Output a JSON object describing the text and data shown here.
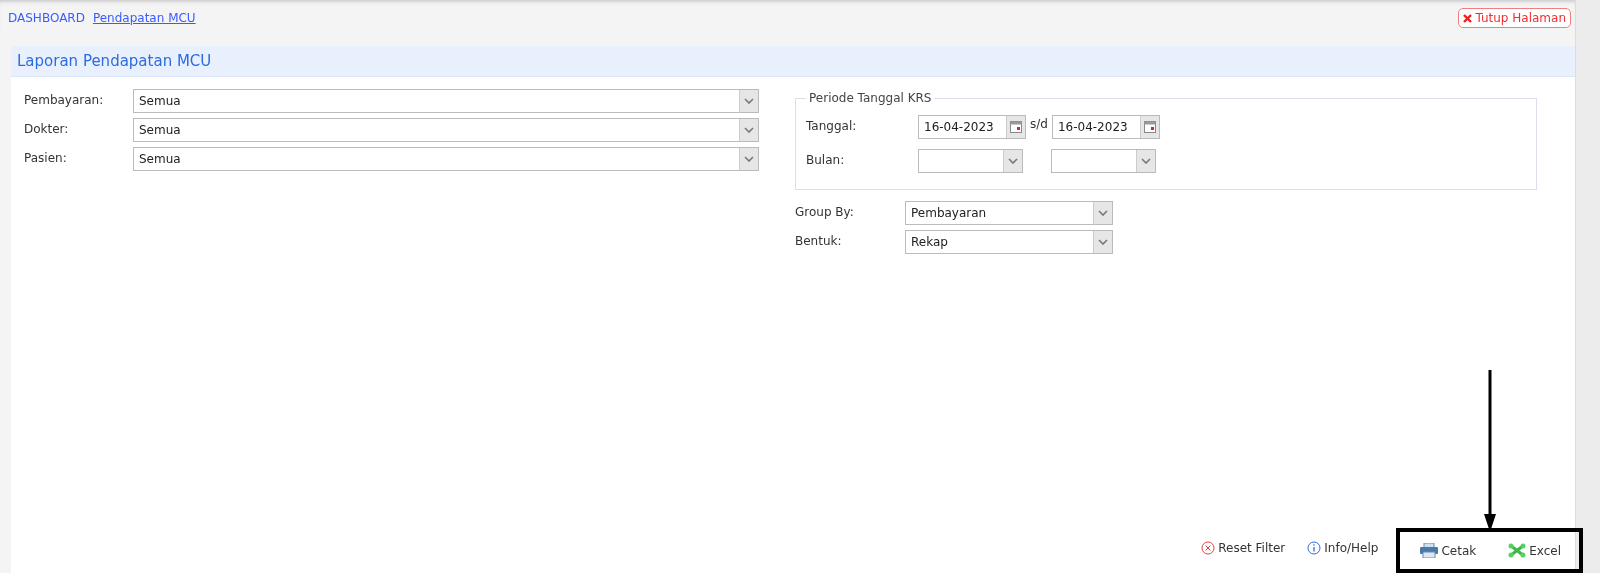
{
  "breadcrumb": [
    {
      "label": "DASHBOARD",
      "selected": false
    },
    {
      "label": "Pendapatan MCU",
      "selected": true
    }
  ],
  "close_button": {
    "label": "Tutup Halaman"
  },
  "panel": {
    "title": "Laporan Pendapatan MCU"
  },
  "filters": [
    {
      "label": "Pembayaran:",
      "value": "Semua"
    },
    {
      "label": "Dokter:",
      "value": "Semua"
    },
    {
      "label": "Pasien:",
      "value": "Semua"
    }
  ],
  "period": {
    "legend": "Periode Tanggal KRS",
    "date_label": "Tanggal:",
    "date_from": "16-04-2023",
    "separator": "s/d",
    "date_to": "16-04-2023",
    "month_label": "Bulan:"
  },
  "options": [
    {
      "label": "Group By:",
      "value": "Pembayaran"
    },
    {
      "label": "Bentuk:",
      "value": "Rekap"
    }
  ],
  "actions": [
    {
      "kind": "reset",
      "label": "Reset Filter",
      "highlighted": false
    },
    {
      "kind": "info",
      "label": "Info/Help",
      "highlighted": false
    },
    {
      "kind": "print",
      "label": "Cetak",
      "highlighted": true
    },
    {
      "kind": "excel",
      "label": "Excel",
      "highlighted": true
    }
  ]
}
